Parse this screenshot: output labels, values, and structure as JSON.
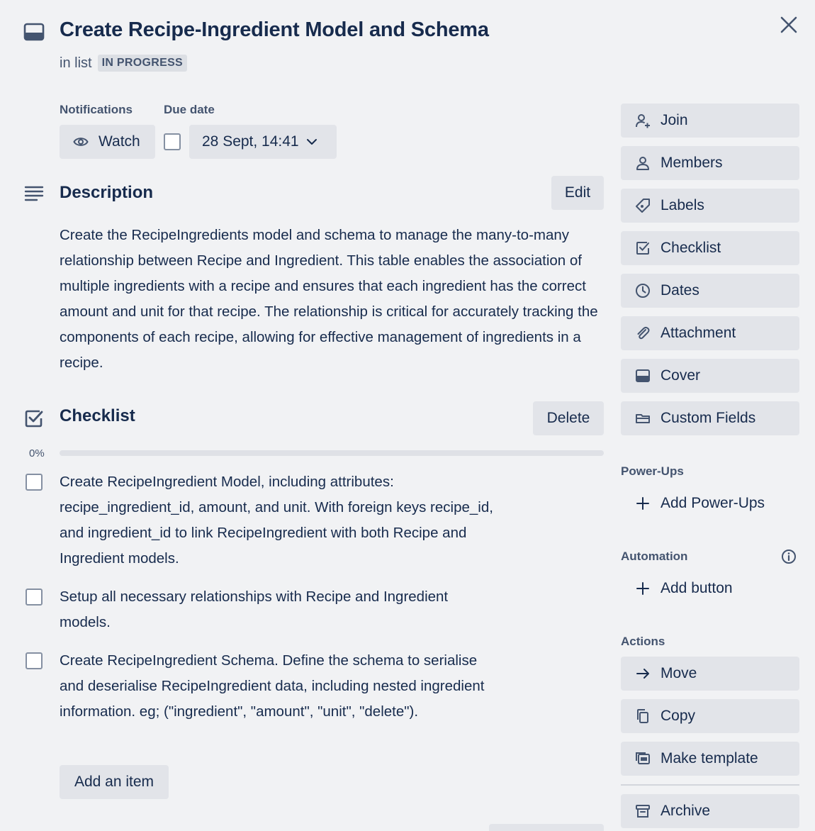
{
  "card": {
    "title": "Create Recipe-Ingredient Model and Schema",
    "in_list_label": "in list",
    "list_name": "IN PROGRESS"
  },
  "notifications": {
    "label": "Notifications",
    "watch_label": "Watch"
  },
  "due_date": {
    "label": "Due date",
    "value": "28 Sept, 14:41",
    "checked": false
  },
  "description": {
    "title": "Description",
    "edit_label": "Edit",
    "text": "Create the RecipeIngredients model and schema to manage the many-to-many relationship between Recipe and Ingredient. This table enables the association of multiple ingredients with a recipe and ensures that each ingredient has the correct amount and unit for that recipe. The relationship is critical for accurately tracking the components of each recipe, allowing for effective management of ingredients in a recipe."
  },
  "checklist": {
    "title": "Checklist",
    "delete_label": "Delete",
    "progress_label": "0%",
    "progress": 0,
    "items": [
      {
        "text": "Create RecipeIngredient Model, including attributes: recipe_ingredient_id, amount, and unit. With foreign keys recipe_id, and ingredient_id to link RecipeIngredient with both Recipe and Ingredient models.",
        "checked": false
      },
      {
        "text": "Setup all necessary relationships with Recipe and Ingredient models.",
        "checked": false
      },
      {
        "text": "Create RecipeIngredient Schema. Define the schema to serialise and deserialise RecipeIngredient data, including nested ingredient information. eg; (\"ingredient\", \"amount\", \"unit\", \"delete\").",
        "checked": false
      }
    ],
    "add_item_label": "Add an item"
  },
  "sidebar": {
    "add_to_card": [
      {
        "label": "Join",
        "icon": "person-add-icon"
      },
      {
        "label": "Members",
        "icon": "person-icon"
      },
      {
        "label": "Labels",
        "icon": "label-tag-icon"
      },
      {
        "label": "Checklist",
        "icon": "checkbox-icon"
      },
      {
        "label": "Dates",
        "icon": "clock-icon"
      },
      {
        "label": "Attachment",
        "icon": "paperclip-icon"
      },
      {
        "label": "Cover",
        "icon": "cover-icon"
      },
      {
        "label": "Custom Fields",
        "icon": "custom-fields-icon"
      }
    ],
    "power_ups": {
      "heading": "Power-Ups",
      "add_label": "Add Power-Ups"
    },
    "automation": {
      "heading": "Automation",
      "add_label": "Add button"
    },
    "actions": {
      "heading": "Actions",
      "items": [
        {
          "label": "Move",
          "icon": "arrow-right-icon"
        },
        {
          "label": "Copy",
          "icon": "copy-icon"
        },
        {
          "label": "Make template",
          "icon": "template-icon"
        },
        {
          "label": "Archive",
          "icon": "archive-icon"
        }
      ]
    }
  },
  "colors": {
    "background": "#f1f2f4",
    "button": "#e2e4e9",
    "text": "#172b4d",
    "subtle_text": "#44546f",
    "progress_fill": "#579dff"
  }
}
